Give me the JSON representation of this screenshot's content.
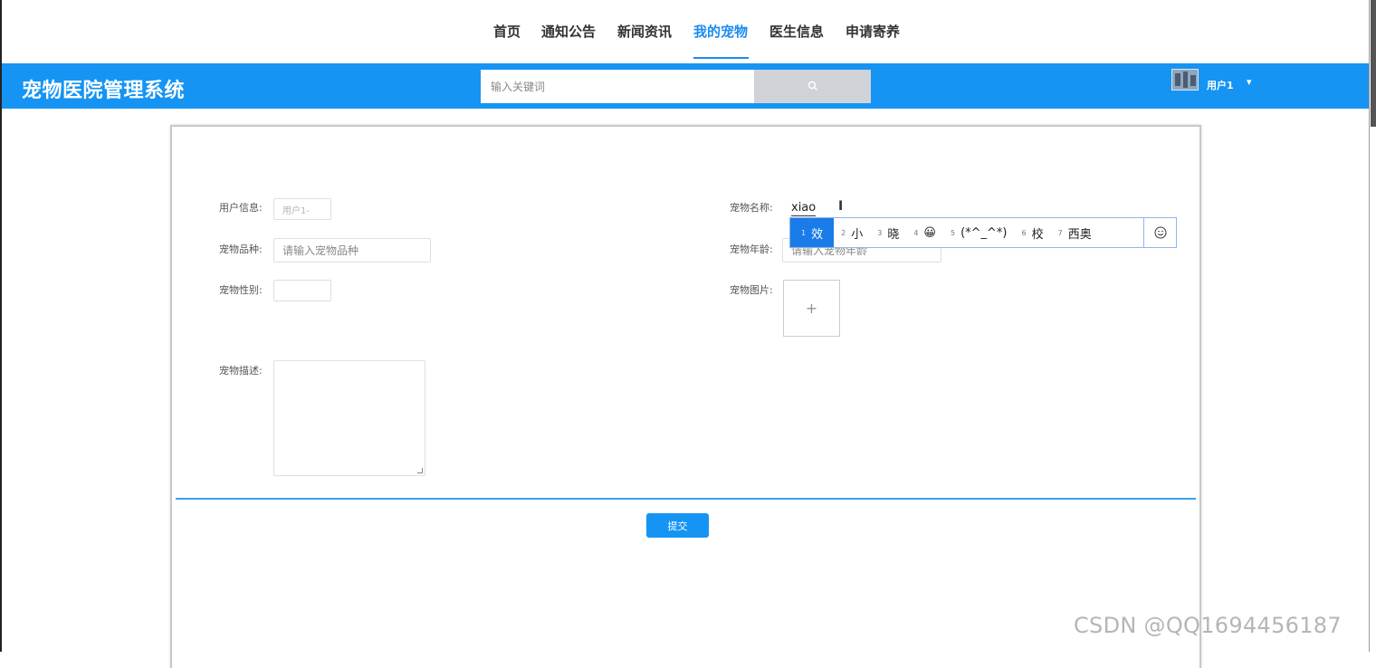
{
  "nav": {
    "items": [
      {
        "label": "首页"
      },
      {
        "label": "通知公告"
      },
      {
        "label": "新闻资讯"
      },
      {
        "label": "我的宠物"
      },
      {
        "label": "医生信息"
      },
      {
        "label": "申请寄养"
      }
    ],
    "active": "我的宠物"
  },
  "header": {
    "title": "宠物医院管理系统",
    "search_placeholder": "输入关键词",
    "search_icon": "search-icon",
    "user_name": "用户1",
    "user_caret": "▾"
  },
  "form": {
    "user_info_label": "用户信息:",
    "user_info_value": "用户1-",
    "pet_breed_label": "宠物品种:",
    "pet_breed_placeholder": "请输入宠物品种",
    "pet_gender_label": "宠物性别:",
    "pet_gender_value": "",
    "pet_desc_label": "宠物描述:",
    "pet_name_label": "宠物名称:",
    "pet_name_composition": "xiao",
    "pet_age_label": "宠物年龄:",
    "pet_age_placeholder": "请输入宠物年龄",
    "pet_image_label": "宠物图片:",
    "upload_symbol": "+",
    "submit_label": "提交"
  },
  "ime": {
    "candidates": [
      {
        "num": "1",
        "text": "效"
      },
      {
        "num": "2",
        "text": "小"
      },
      {
        "num": "3",
        "text": "晓"
      },
      {
        "num": "4",
        "text": "😀"
      },
      {
        "num": "5",
        "text": "(*^_^*)"
      },
      {
        "num": "6",
        "text": "校"
      },
      {
        "num": "7",
        "text": "西奥"
      }
    ],
    "emoji_button_icon": "smiley-icon"
  },
  "watermark": "CSDN @QQ1694456187",
  "colors": {
    "primary": "#1594f4",
    "ime_selected": "#1a7ce8"
  }
}
